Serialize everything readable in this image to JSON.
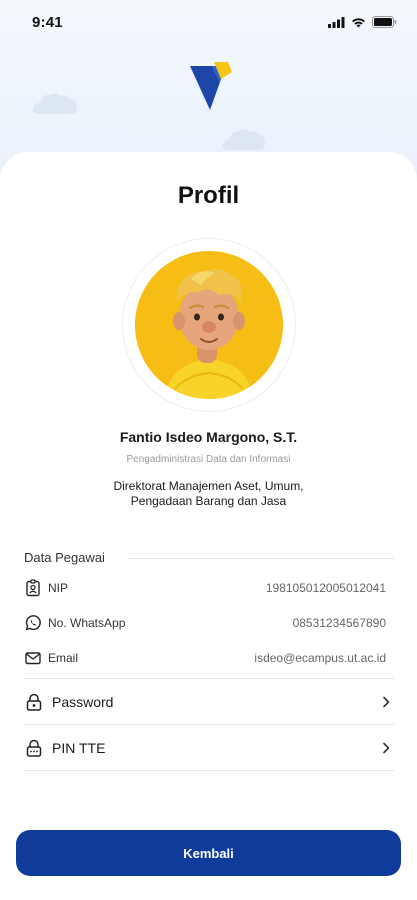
{
  "status_bar": {
    "time": "9:41",
    "icons": [
      "signal-icon",
      "wifi-icon",
      "battery-icon"
    ]
  },
  "brand": {
    "logo_icon": "brand-logo-icon",
    "colors": {
      "blue": "#1e45a8",
      "yellow": "#f6c514"
    }
  },
  "header": {
    "title": "Profil"
  },
  "profile": {
    "avatar_icon": "avatar-illustration",
    "name": "Fantio Isdeo Margono, S.T.",
    "role": "Pengadministrasi Data dan Informasi",
    "department": "Direktorat Manajemen Aset, Umum, Pengadaan Barang dan Jasa"
  },
  "employee_data": {
    "section_title": "Data Pegawai",
    "rows": [
      {
        "icon": "id-badge-icon",
        "label": "NIP",
        "value": "198105012005012041"
      },
      {
        "icon": "whatsapp-icon",
        "label": "No. WhatsApp",
        "value": "08531234567890"
      },
      {
        "icon": "mail-icon",
        "label": "Email",
        "value": "isdeo@ecampus.ut.ac.id"
      }
    ]
  },
  "settings": {
    "items": [
      {
        "icon": "lock-icon",
        "label": "Password"
      },
      {
        "icon": "lock-keypad-icon",
        "label": "PIN TTE"
      }
    ]
  },
  "footer": {
    "back_label": "Kembali",
    "button_color": "#0f3c9b"
  }
}
